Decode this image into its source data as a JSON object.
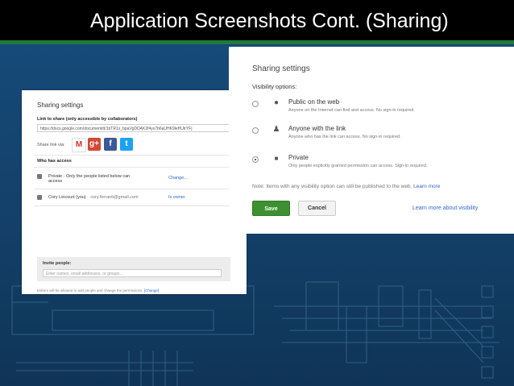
{
  "slide": {
    "title": "Application Screenshots Cont. (Sharing)"
  },
  "left_panel": {
    "heading": "Sharing settings",
    "link_label": "Link to share (only accessible by collaborators)",
    "link_url": "https://docs.google.com/document/d/1bTR1x_bpaVgDDAK2f4ys7b6aUHK9leHUtrYFj",
    "share_via_label": "Share link via:",
    "social": [
      {
        "name": "gmail-icon",
        "glyph": "M",
        "color": "#ffffff",
        "fg": "#d93025"
      },
      {
        "name": "google-plus-icon",
        "glyph": "g+",
        "color": "#d34836",
        "fg": "#ffffff"
      },
      {
        "name": "facebook-icon",
        "glyph": "f",
        "color": "#3b5998",
        "fg": "#ffffff"
      },
      {
        "name": "twitter-icon",
        "glyph": "t",
        "color": "#1da1f2",
        "fg": "#ffffff"
      }
    ],
    "who_has_access": "Who has access",
    "access_row1_text": "Private - Only the people listed below can access",
    "access_row1_action": "Change...",
    "access_row2_name": "Cory Lincourt (you)",
    "access_row2_email": "cory.ferranti@gmail.com",
    "access_row2_role": "Is owner",
    "invite_label": "Invite people:",
    "invite_placeholder": "Enter names, email addresses, or groups...",
    "footer_text": "Editors will be allowed to add people and change the permissions.",
    "footer_link": "[Change]"
  },
  "right_panel": {
    "heading": "Sharing settings",
    "visibility_label": "Visibility options:",
    "options": [
      {
        "title": "Public on the web",
        "desc": "Anyone on the Internet can find and access. No sign-in required.",
        "icon": "globe-icon",
        "selected": false
      },
      {
        "title": "Anyone with the link",
        "desc": "Anyone who has the link can access. No sign-in required.",
        "icon": "person-icon",
        "selected": false
      },
      {
        "title": "Private",
        "desc": "Only people explicitly granted permission can access. Sign-in required.",
        "icon": "lock-icon",
        "selected": true
      }
    ],
    "note_text": "Note: Items with any visibility option can still be published to the web.",
    "note_link": "Learn more",
    "save_label": "Save",
    "cancel_label": "Cancel",
    "learn_more_label": "Learn more about visibility"
  },
  "colors": {
    "title_bar": "#000000",
    "accent_green": "#1f7a3a",
    "slide_blue": "#164a78",
    "save_button": "#3d9130",
    "link_blue": "#3366cc"
  }
}
